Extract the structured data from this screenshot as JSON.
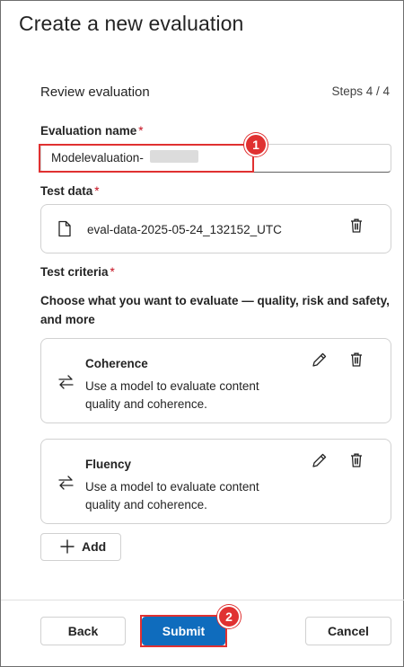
{
  "dialog": {
    "title": "Create a new evaluation"
  },
  "review": {
    "title": "Review evaluation",
    "steps": "Steps 4 / 4"
  },
  "evaluation_name": {
    "label": "Evaluation name",
    "required_mark": "*",
    "value": "Modelevaluation-"
  },
  "test_data": {
    "label": "Test data",
    "required_mark": "*",
    "file_name": "eval-data-2025-05-24_132152_UTC",
    "icon": "document-icon",
    "delete_icon": "trash-icon"
  },
  "test_criteria": {
    "label": "Test criteria",
    "required_mark": "*",
    "description": "Choose what you want to evaluate — quality, risk and safety, and more",
    "items": [
      {
        "title": "Coherence",
        "description": "Use a model to evaluate content quality and coherence.",
        "icon": "arrows-swap-icon"
      },
      {
        "title": "Fluency",
        "description": "Use a model to evaluate content quality and coherence.",
        "icon": "arrows-swap-icon"
      }
    ],
    "add_label": "Add"
  },
  "footer": {
    "back_label": "Back",
    "submit_label": "Submit",
    "cancel_label": "Cancel"
  },
  "annotations": {
    "step1": "1",
    "step2": "2",
    "highlight_color": "#e03131"
  },
  "colors": {
    "primary": "#0f6cbd",
    "required": "#c50f1f"
  }
}
